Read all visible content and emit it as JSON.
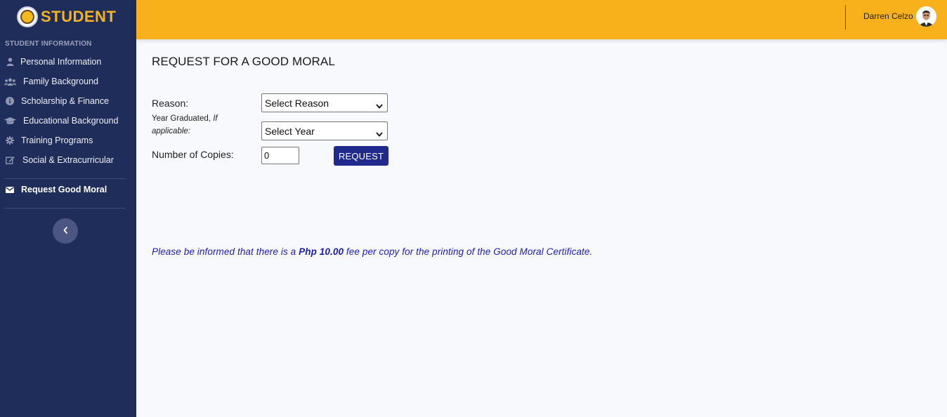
{
  "brand": {
    "title": "STUDENT"
  },
  "sidebar": {
    "section_heading": "STUDENT INFORMATION",
    "items": [
      {
        "label": "Personal Information",
        "icon": "user-icon"
      },
      {
        "label": "Family Background",
        "icon": "users-icon"
      },
      {
        "label": "Scholarship & Finance",
        "icon": "info-icon"
      },
      {
        "label": "Educational Background",
        "icon": "graduation-cap-icon"
      },
      {
        "label": "Training Programs",
        "icon": "gear-icon"
      },
      {
        "label": "Social & Extracurricular",
        "icon": "edit-icon"
      }
    ],
    "active_item": {
      "label": "Request Good Moral",
      "icon": "envelope-icon"
    }
  },
  "topbar": {
    "user_name": "Darren Celzo"
  },
  "main": {
    "title": "REQUEST FOR A GOOD MORAL",
    "reason_label": "Reason:",
    "reason_select_value": "Select Reason",
    "year_label": "Year Graduated,",
    "year_label_italic": "If applicable:",
    "year_select_value": "Select Year",
    "copies_label": "Number of Copies:",
    "copies_value": "0",
    "request_button": "REQUEST",
    "notice_before": "Please be informed that there is a ",
    "notice_amount": "Php 10.00",
    "notice_after": " fee per copy for the printing of the Good Moral Certificate."
  },
  "colors": {
    "sidebar_bg": "#1f2d5b",
    "topbar_bg": "#f8b11a",
    "brand_accent": "#f7b31c",
    "button_bg": "#1f2a8c",
    "notice_text": "#1b1bb8"
  }
}
